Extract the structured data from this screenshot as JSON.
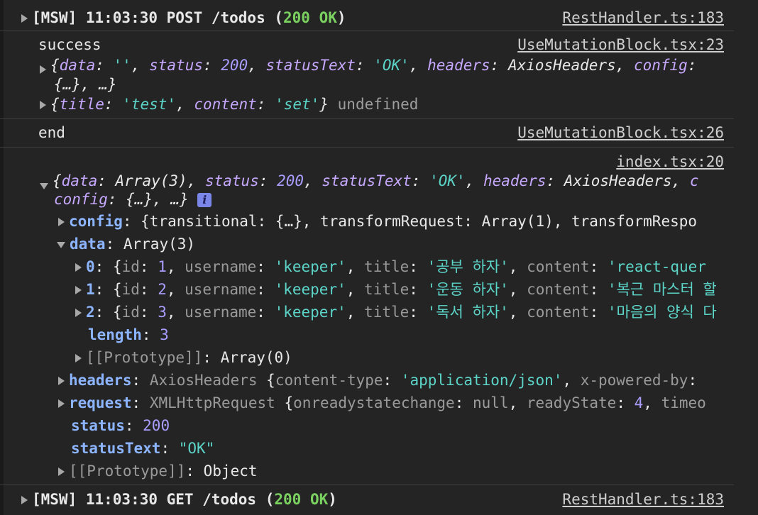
{
  "msw_post": {
    "prefix": "[MSW] 11:03:30 POST /todos (",
    "status": "200 OK",
    "suffix": ")",
    "source": "RestHandler.ts:183"
  },
  "success_block": {
    "label": "success",
    "source": "UseMutationBlock.tsx:23",
    "line1": {
      "k_data": "data",
      "v_data": "''",
      "k_status": "status",
      "v_status": "200",
      "k_statusText": "statusText",
      "v_statusText": "'OK'",
      "k_headers": "headers",
      "v_headers": "AxiosHeaders",
      "k_config": "config"
    },
    "line1b": "{…}, …}",
    "line2": {
      "k_title": "title",
      "v_title": "'test'",
      "k_content": "content",
      "v_content": "'set'",
      "tail": "undefined"
    }
  },
  "end_block": {
    "label": "end",
    "source": "UseMutationBlock.tsx:26"
  },
  "index_block": {
    "source": "index.tsx:20",
    "summary1": {
      "k_data": "data",
      "v_data": "Array(3)",
      "k_status": "status",
      "v_status": "200",
      "k_statusText": "statusText",
      "v_statusText": "'OK'",
      "k_headers": "headers",
      "v_headers": "AxiosHeaders",
      "tail": "c"
    },
    "summary2": {
      "k_config": "config",
      "v_config": "{…}, …}"
    },
    "info_icon": "i",
    "config": {
      "key": "config",
      "value": "{transitional: {…}, transformRequest: Array(1), transformRespo"
    },
    "data": {
      "key": "data",
      "value": "Array(3)"
    },
    "items": [
      {
        "idx": "0",
        "id": "1",
        "username": "'keeper'",
        "title": "'공부 하자'",
        "content": "'react-quer"
      },
      {
        "idx": "1",
        "id": "2",
        "username": "'keeper'",
        "title": "'운동 하자'",
        "content": "'복근 마스터 할"
      },
      {
        "idx": "2",
        "id": "3",
        "username": "'keeper'",
        "title": "'독서 하자'",
        "content": "'마음의 양식 다"
      }
    ],
    "item_keys": {
      "id": "id",
      "username": "username",
      "title": "title",
      "content": "content"
    },
    "length": {
      "key": "length",
      "value": "3"
    },
    "data_proto": {
      "key": "[[Prototype]]",
      "value": "Array(0)"
    },
    "headers": {
      "key": "headers",
      "type": "AxiosHeaders",
      "k1": "content-type",
      "v1": "'application/json'",
      "k2": "x-powered-by"
    },
    "request": {
      "key": "request",
      "type": "XMLHttpRequest",
      "k1": "onreadystatechange",
      "v1": "null",
      "k2": "readyState",
      "v2": "4",
      "k3": "timeo"
    },
    "status": {
      "key": "status",
      "value": "200"
    },
    "statusText": {
      "key": "statusText",
      "value": "\"OK\""
    },
    "proto": {
      "key": "[[Prototype]]",
      "value": "Object"
    }
  },
  "msw_get": {
    "prefix": "[MSW] 11:03:30 GET /todos (",
    "status": "200 OK",
    "suffix": ")",
    "source": "RestHandler.ts:183"
  },
  "colors": {
    "background": "#242424",
    "status_green": "#7ad15f",
    "string": "#5cd5c8",
    "number": "#a89dff",
    "key": "#8cb4ff"
  }
}
